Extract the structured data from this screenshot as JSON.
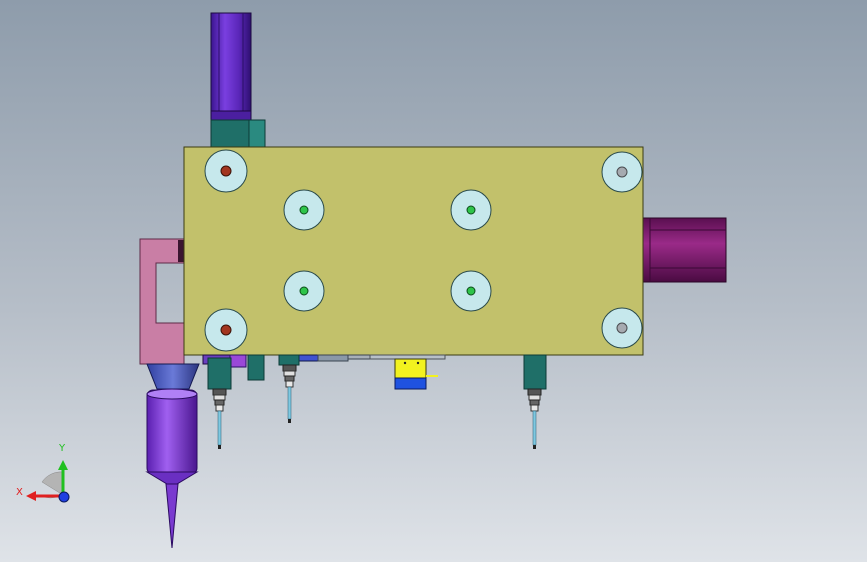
{
  "viewport": {
    "background_top": "#8e9cab",
    "background_bottom": "#dfe3e8"
  },
  "colors": {
    "plate": "#c2c16b",
    "hole_ring": "#c6e8ec",
    "hole_green": "#2ec44a",
    "hole_red": "#a2351f",
    "hole_gray": "#a6aab0",
    "motor_purple": "#6a2fc2",
    "teal": "#1f7a6e",
    "pink_bracket": "#c97ea5",
    "side_motor": "#7c1a6e",
    "tool_purple": "#8a3be0",
    "label_yellow": "#f2f21f",
    "label_blue": "#1f52e0"
  },
  "triad": {
    "x_label": "X",
    "y_label": "Y",
    "x_color": "#e02020",
    "y_color": "#20c020",
    "z_color": "#1f3fe0"
  },
  "parts": [
    "top-motor",
    "mounting-plate",
    "side-motor",
    "pink-bracket",
    "spindle-tool",
    "probe-left",
    "probe-middle",
    "probe-right",
    "label-block"
  ]
}
